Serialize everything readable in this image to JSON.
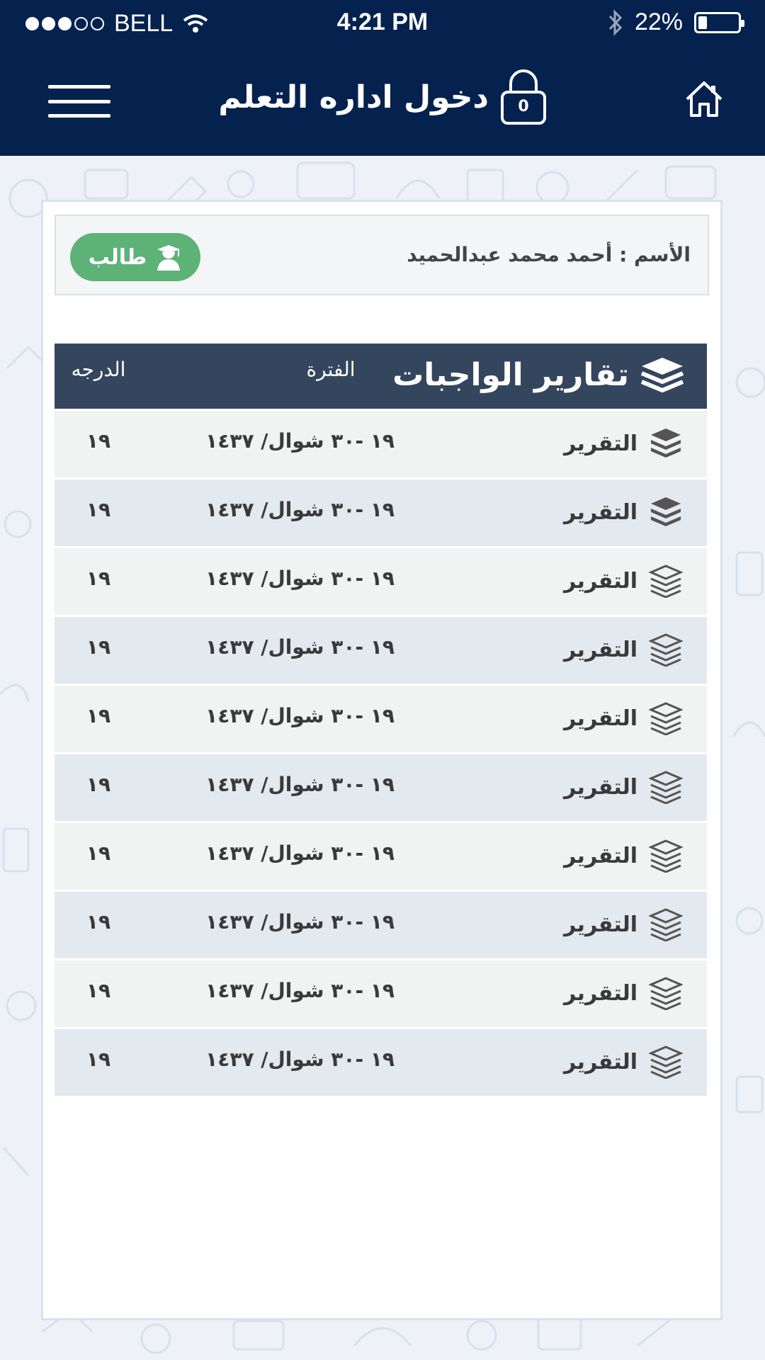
{
  "status_bar": {
    "carrier": "BELL",
    "time": "4:21 PM",
    "battery": "22%",
    "battery_level": 0.22,
    "signal_bars_filled": 3,
    "signal_bars_total": 5
  },
  "header": {
    "title": "دخول اداره التعلم",
    "lock_count": "0",
    "icons": [
      "menu-icon",
      "lock-icon",
      "home-icon"
    ]
  },
  "profile": {
    "name": "الأسم : أحمد محمد عبدالحميد",
    "role_label": "طالب",
    "role_icon": "student-icon"
  },
  "table": {
    "title": "تقارير الواجبات",
    "title_icon": "layers-icon",
    "columns": {
      "period": "الفترة",
      "grade": "الدرجه"
    },
    "rows": [
      {
        "label": "التقرير",
        "period": "١٩ -٣٠ شوال/ ١٤٣٧",
        "grade": "١٩"
      },
      {
        "label": "التقرير",
        "period": "١٩ -٣٠ شوال/ ١٤٣٧",
        "grade": "١٩"
      },
      {
        "label": "التقرير",
        "period": "١٩ -٣٠ شوال/ ١٤٣٧",
        "grade": "١٩"
      },
      {
        "label": "التقرير",
        "period": "١٩ -٣٠ شوال/ ١٤٣٧",
        "grade": "١٩"
      },
      {
        "label": "التقرير",
        "period": "١٩ -٣٠ شوال/ ١٤٣٧",
        "grade": "١٩"
      },
      {
        "label": "التقرير",
        "period": "١٩ -٣٠ شوال/ ١٤٣٧",
        "grade": "١٩"
      },
      {
        "label": "التقرير",
        "period": "١٩ -٣٠ شوال/ ١٤٣٧",
        "grade": "١٩"
      },
      {
        "label": "التقرير",
        "period": "١٩ -٣٠ شوال/ ١٤٣٧",
        "grade": "١٩"
      },
      {
        "label": "التقرير",
        "period": "١٩ -٣٠ شوال/ ١٤٣٧",
        "grade": "١٩"
      },
      {
        "label": "التقرير",
        "period": "١٩ -٣٠ شوال/ ١٤٣٧",
        "grade": "١٩"
      }
    ]
  },
  "colors": {
    "header_bg": "#05224f",
    "table_header_bg": "#34465e",
    "badge_green": "#5db277",
    "row_odd": "#f1f2f2",
    "row_even": "#e4e8ef"
  }
}
